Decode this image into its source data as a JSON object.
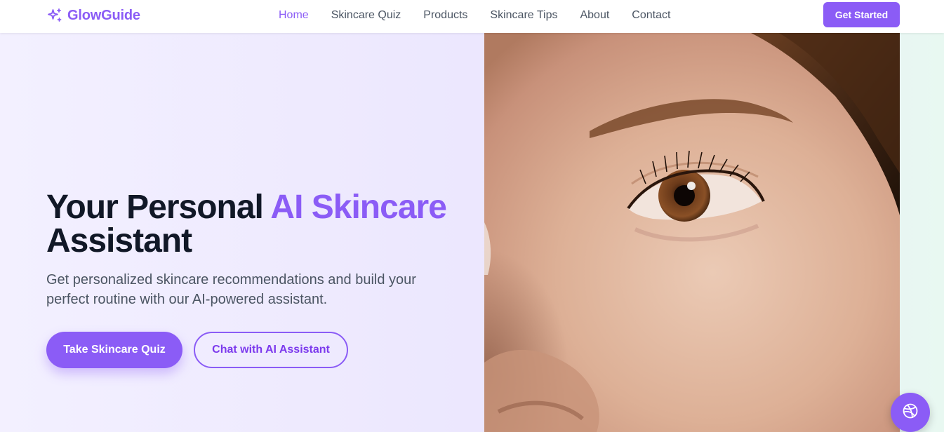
{
  "navbar": {
    "brand": "GlowGuide",
    "brand_icon": "sparkles-icon",
    "links": [
      {
        "label": "Home",
        "active": true
      },
      {
        "label": "Skincare Quiz",
        "active": false
      },
      {
        "label": "Products",
        "active": false
      },
      {
        "label": "Skincare Tips",
        "active": false
      },
      {
        "label": "About",
        "active": false
      },
      {
        "label": "Contact",
        "active": false
      }
    ],
    "cta_label": "Get Started"
  },
  "hero": {
    "title_part1": "Your Personal ",
    "title_accent": "AI Skincare",
    "title_part2": "Assistant",
    "subtitle": "Get personalized skincare recommendations and build your perfect routine with our AI-powered assistant.",
    "primary_button": "Take Skincare Quiz",
    "secondary_button": "Chat with AI Assistant"
  },
  "fab": {
    "icon": "dribbble-icon"
  },
  "colors": {
    "accent": "#8b5cf6",
    "accent_dark": "#7c3aed",
    "text_dark": "#111827",
    "text_muted": "#4b5563"
  }
}
